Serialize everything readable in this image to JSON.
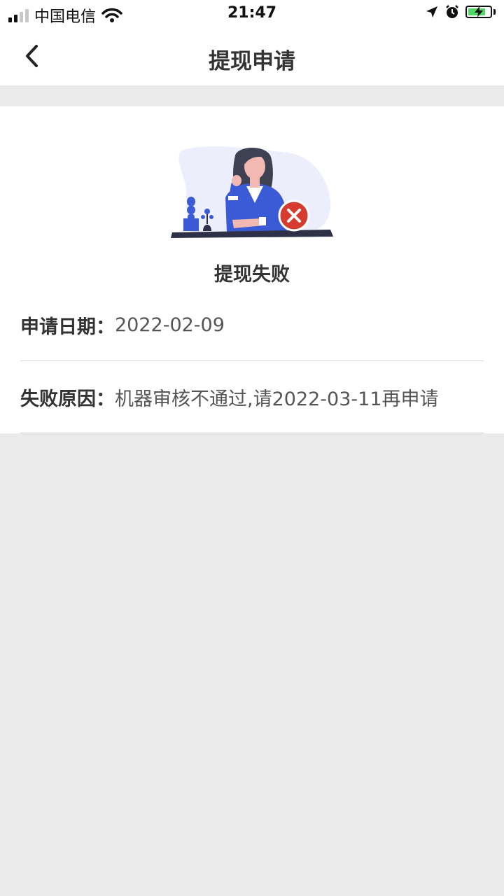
{
  "status_bar": {
    "carrier": "中国电信",
    "time": "21:47",
    "icons": [
      "signal-icon",
      "wifi-icon",
      "location-icon",
      "alarm-icon",
      "battery-charging-icon"
    ]
  },
  "nav": {
    "title": "提现申请",
    "back_icon": "chevron-left-icon"
  },
  "result": {
    "illustration": "woman-at-desk-with-error-illustration",
    "status_text": "提现失败",
    "status_color": "#d63b2f"
  },
  "details": {
    "date_label": "申请日期：",
    "date_value": "2022-02-09",
    "reason_label": "失败原因：",
    "reason_value": "机器审核不通过,请2022-03-11再申请"
  },
  "colors": {
    "accent_blue": "#3b5bd6",
    "error_red": "#d63b2f",
    "page_bg": "#eaeaea"
  }
}
